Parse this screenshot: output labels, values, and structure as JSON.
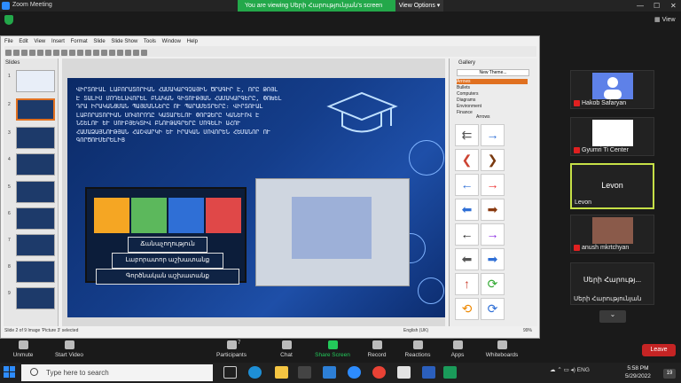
{
  "window": {
    "title": "Zoom Meeting"
  },
  "banner": {
    "text": "You are viewing Սերի Հարությունյան's screen",
    "view_options": "View Options ▾"
  },
  "view_label": "View",
  "impress": {
    "menu": [
      "File",
      "Edit",
      "View",
      "Insert",
      "Format",
      "Slide",
      "Slide Show",
      "Tools",
      "Window",
      "Help"
    ],
    "slides_label": "Slides",
    "thumb_numbers": [
      "1",
      "2",
      "3",
      "4",
      "5",
      "6",
      "7",
      "8",
      "9"
    ],
    "slide_text": "ՎԻՐՏՈՒԱԼ ԼԱԲՈՐԱՏՈՐԻԱՆ ՀԱՄԱԿԱՐԳՉԱՅԻՆ ԾՐԱԳԻՐ Է, ՈՐԸ ԹՈՅԼ Է ՏԱԼԻՍ ՄՈԴԵԼԱՎՈՐԵԼ ԲՆԱԿԱՆ ԳԻՏՈՒԹՅԱՆ ՀԱՄԱԿԱՐԳԵՐԸ, ՓՈԽԵԼ ԴՐԱ ԻՐԱԿԱՆՑՄԱՆ ՊԱՅՄԱՆՆԵՐԸ ՈՒ ՊԱՐԱՄԵՏՐԵՐԸ։ ՎԻՐՏՈՒԱԼ ԼԱԲՈՐԱՏՈՐԻԱՆ ՍՈՎՈՐՈՂԸ ԿԱՏԱՐԵԼՈՒ ՓՈՐՁԵՐԸ ԿԱՆԵՒՈՎ Է ՆՇԵԼՈՒ ԵՒ ՍՈՒԲՅԵԿՏԻՎ ԲՆՈՒԹԱԳՐԵՐԸ ՄՈԳԵԼԻ ԱՀՈՒ ՀԱՄԱՁԱՅՆՈՒԹՅԱՆ ՀԱՇՎԱՐԿԻ ԵՒ ԻՐԱԿԱՆ ՍՈՎՈՐԵՆ ՀԵՄԱՆՈՐ ՈՒ ԳՈՐԾՈՒՄԵՐԵԼԻՑ",
    "pyramid": [
      "Ճանաչողություն",
      "Լաբորատոր աշխատանք",
      "Գործնական աշխատանք"
    ],
    "tile_labels": [
      "",
      "",
      "",
      ""
    ],
    "gallery_label": "Gallery",
    "new_theme": "New Theme...",
    "gallery_items": [
      "Arrows",
      "Bullets",
      "Computers",
      "Diagrams",
      "Environment",
      "Finance"
    ],
    "gallery_section": "Arrows",
    "status": "Slide 2 of 9    Image 'Picture 3' selected",
    "status_right": "English (UK)",
    "zoom": "99%"
  },
  "participants": [
    {
      "name": "Hakob Safaryan"
    },
    {
      "name": "Gyumri Ti Center"
    },
    {
      "name": "Levon"
    },
    {
      "name": "anush mkrtchyan"
    },
    {
      "name": "Սերի Հարությ...",
      "sub": "Սերի Հարությունյան"
    }
  ],
  "controls": [
    {
      "label": "Unmute"
    },
    {
      "label": "Start Video"
    },
    {
      "label": "Participants",
      "count": "7"
    },
    {
      "label": "Chat"
    },
    {
      "label": "Share Screen"
    },
    {
      "label": "Record"
    },
    {
      "label": "Reactions"
    },
    {
      "label": "Apps"
    },
    {
      "label": "Whiteboards"
    }
  ],
  "leave": "Leave",
  "taskbar": {
    "search_placeholder": "Type here to search",
    "lang": "ENG",
    "time": "5:58 PM",
    "date": "5/29/2022",
    "badge": "19"
  },
  "colors": {
    "zoom_green": "#23a84a",
    "leave_red": "#c52424",
    "active_speaker": "#c6e047"
  }
}
